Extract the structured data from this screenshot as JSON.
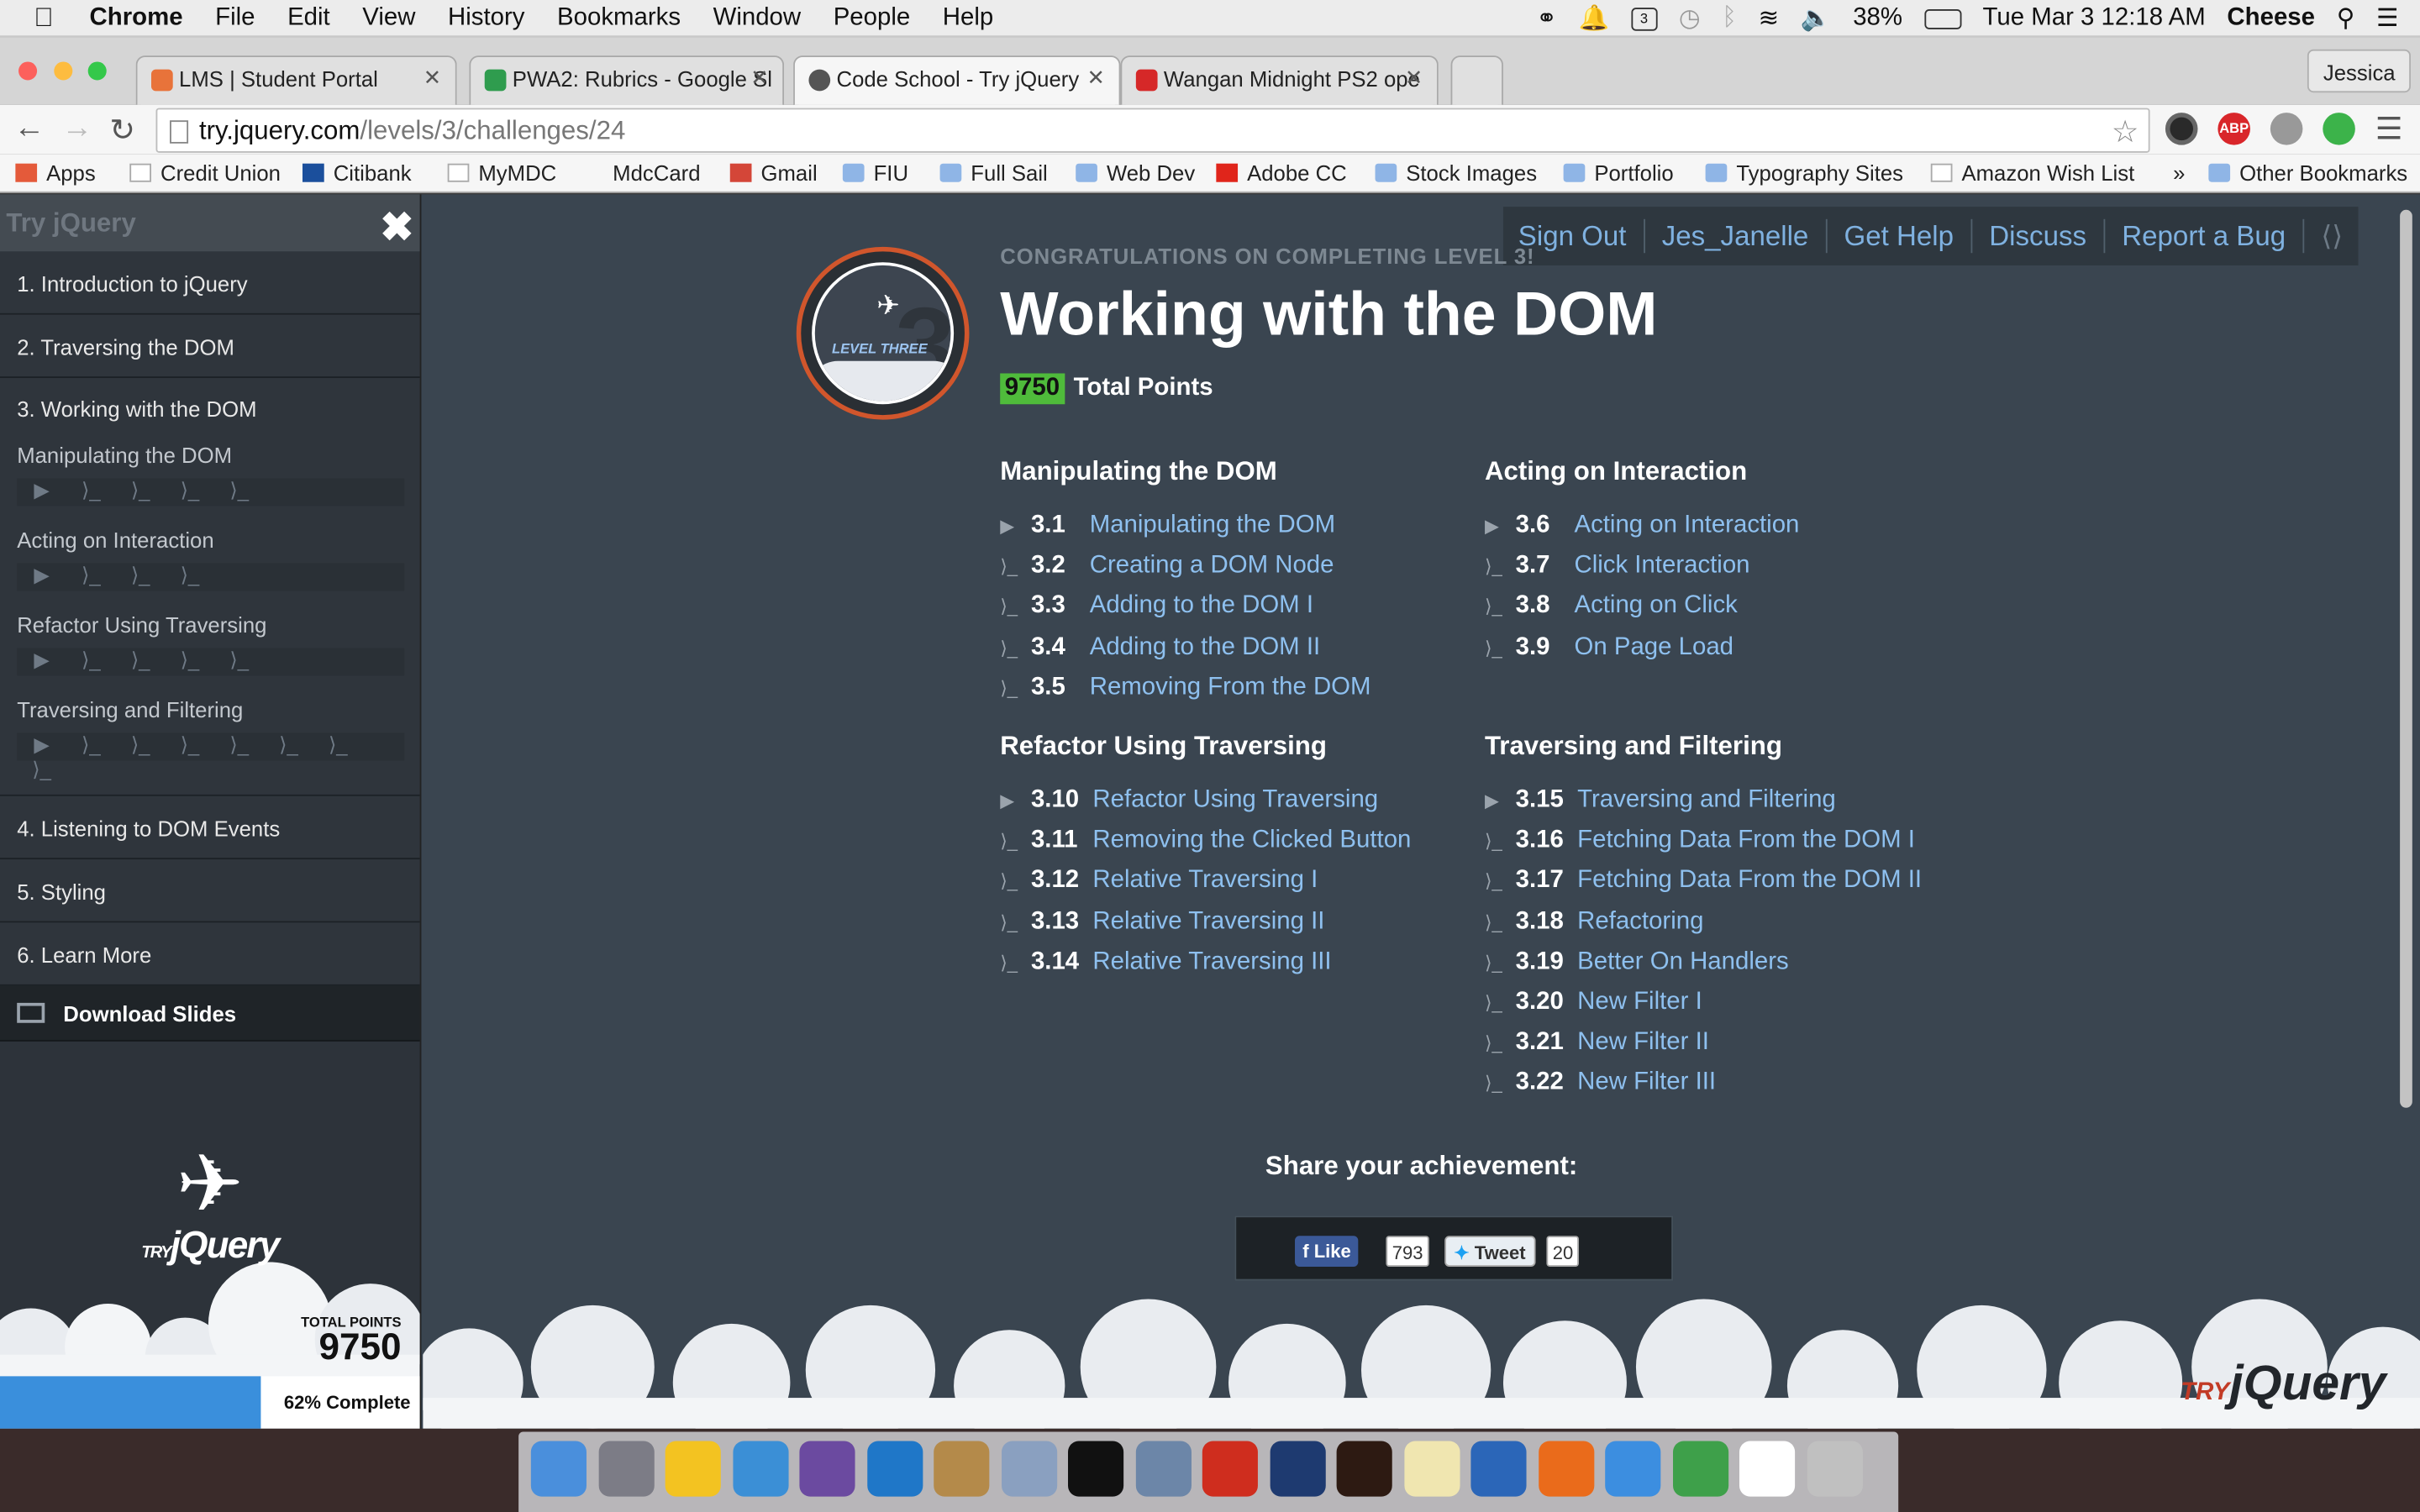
{
  "menubar": {
    "app": "Chrome",
    "items": [
      "File",
      "Edit",
      "View",
      "History",
      "Bookmarks",
      "Window",
      "People",
      "Help"
    ],
    "battery": "38%",
    "datetime": "Tue Mar 3  12:18 AM",
    "user": "Cheese",
    "calendar_badge": "3"
  },
  "tabs": [
    {
      "label": "LMS | Student Portal",
      "color": "#e8733a"
    },
    {
      "label": "PWA2: Rubrics - Google Sl",
      "color": "#2f9c4e"
    },
    {
      "label": "Code School - Try jQuery",
      "color": "#555555"
    },
    {
      "label": "Wangan Midnight PS2 ope",
      "color": "#d62828"
    }
  ],
  "profile": "Jessica",
  "url": {
    "host": "try.jquery.com",
    "path": "/levels/3/challenges/24"
  },
  "bookmarks": [
    "Apps",
    "Credit Union",
    "Citibank",
    "MyMDC",
    "MdcCard",
    "Gmail",
    "FIU",
    "Full Sail",
    "Web Dev",
    "Adobe CC",
    "Stock Images",
    "Portfolio",
    "Typography Sites",
    "Amazon Wish List",
    "»",
    "Other Bookmarks"
  ],
  "sidebar": {
    "title": "Try jQuery",
    "close": "✖",
    "levels": [
      "1. Introduction to jQuery",
      "2. Traversing the DOM",
      "3. Working with the DOM",
      "4. Listening to DOM Events",
      "5. Styling",
      "6. Learn More"
    ],
    "sections": [
      {
        "name": "Manipulating the DOM",
        "marks": [
          "▶",
          "⟩_",
          "⟩_",
          "⟩_",
          "⟩_"
        ]
      },
      {
        "name": "Acting on Interaction",
        "marks": [
          "▶",
          "⟩_",
          "⟩_",
          "⟩_"
        ]
      },
      {
        "name": "Refactor Using Traversing",
        "marks": [
          "▶",
          "⟩_",
          "⟩_",
          "⟩_",
          "⟩_"
        ]
      },
      {
        "name": "Traversing and Filtering",
        "marks": [
          "▶",
          "⟩_",
          "⟩_",
          "⟩_",
          "⟩_",
          "⟩_",
          "⟩_",
          "⟩_"
        ]
      }
    ],
    "download": "Download Slides",
    "total_label": "TOTAL POINTS",
    "total": "9750",
    "progress": 0.62,
    "progress_label": "62% Complete"
  },
  "logo": {
    "small": "TRY",
    "big": "jQuery"
  },
  "topnav": [
    "Sign Out",
    "Jes_Janelle",
    "Get Help",
    "Discuss",
    "Report a Bug"
  ],
  "badge": {
    "number": "3",
    "text": "LEVEL THREE"
  },
  "level": {
    "congrats": "CONGRATULATIONS ON COMPLETING LEVEL 3!",
    "title": "Working with the DOM",
    "points": "9750",
    "points_label": "Total Points",
    "sections": [
      {
        "heading": "Manipulating the DOM",
        "items": [
          [
            "3.1",
            "Manipulating the DOM",
            "video"
          ],
          [
            "3.2",
            "Creating a DOM Node",
            "code"
          ],
          [
            "3.3",
            "Adding to the DOM I",
            "code"
          ],
          [
            "3.4",
            "Adding to the DOM II",
            "code"
          ],
          [
            "3.5",
            "Removing From the DOM",
            "code"
          ]
        ]
      },
      {
        "heading": "Acting on Interaction",
        "items": [
          [
            "3.6",
            "Acting on Interaction",
            "video"
          ],
          [
            "3.7",
            "Click Interaction",
            "code"
          ],
          [
            "3.8",
            "Acting on Click",
            "code"
          ],
          [
            "3.9",
            "On Page Load",
            "code"
          ]
        ]
      },
      {
        "heading": "Refactor Using Traversing",
        "items": [
          [
            "3.10",
            "Refactor Using Traversing",
            "video"
          ],
          [
            "3.11",
            "Removing the Clicked Button",
            "code"
          ],
          [
            "3.12",
            "Relative Traversing I",
            "code"
          ],
          [
            "3.13",
            "Relative Traversing II",
            "code"
          ],
          [
            "3.14",
            "Relative Traversing III",
            "code"
          ]
        ]
      },
      {
        "heading": "Traversing and Filtering",
        "items": [
          [
            "3.15",
            "Traversing and Filtering",
            "video"
          ],
          [
            "3.16",
            "Fetching Data From the DOM I",
            "code"
          ],
          [
            "3.17",
            "Fetching Data From the DOM II",
            "code"
          ],
          [
            "3.18",
            "Refactoring",
            "code"
          ],
          [
            "3.19",
            "Better On Handlers",
            "code"
          ],
          [
            "3.20",
            "New Filter I",
            "code"
          ],
          [
            "3.21",
            "New Filter II",
            "code"
          ],
          [
            "3.22",
            "New Filter III",
            "code"
          ]
        ]
      }
    ],
    "share": "Share your achievement:",
    "like": "Like",
    "like_count": "793",
    "tweet": "Tweet",
    "tweet_count": "20"
  },
  "dock_colors": [
    "#4a8fdc",
    "#7c7c86",
    "#f3c321",
    "#3b8fd6",
    "#6b4aa0",
    "#1f77c8",
    "#b48a4a",
    "#8aa0c0",
    "#111111",
    "#6c86a8",
    "#cf2d1e",
    "#1e3a70",
    "#2d1a12",
    "#f0e6b0",
    "#2b66b8",
    "#ea6b1b",
    "#3c8ee0",
    "#3ea04a",
    "#ffffff",
    "#c0c0c0"
  ]
}
